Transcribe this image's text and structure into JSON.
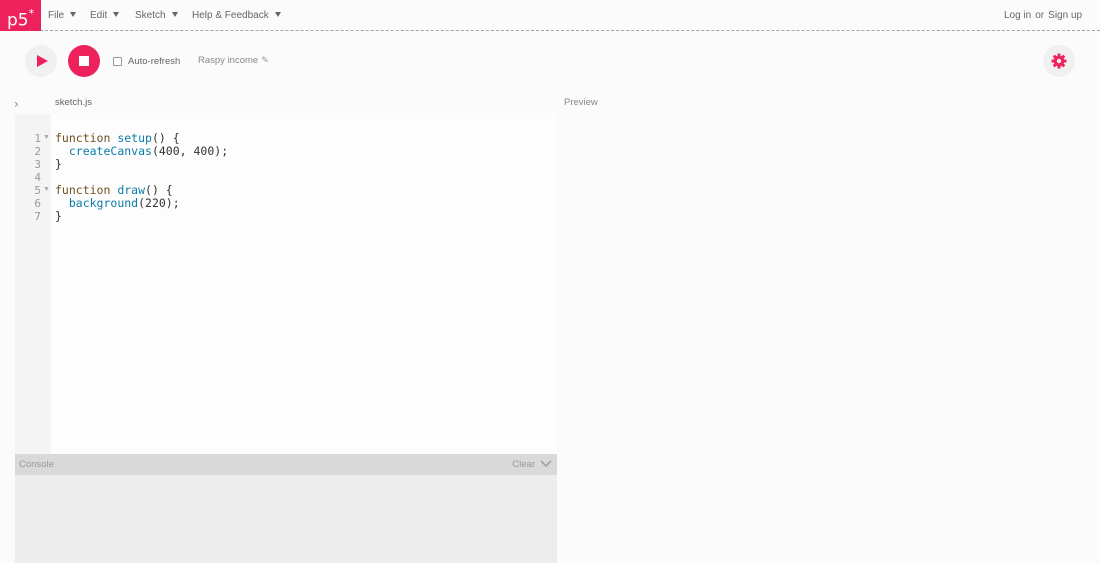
{
  "nav": {
    "logo": "p5",
    "logo_sup": "*",
    "menus": [
      "File",
      "Edit",
      "Sketch",
      "Help & Feedback"
    ],
    "login": "Log in",
    "or": "or",
    "signup": "Sign up"
  },
  "toolbar": {
    "auto_refresh_label": "Auto-refresh",
    "auto_refresh_checked": false,
    "sketch_name": "Raspy income",
    "accent_color": "#ed225d"
  },
  "editor": {
    "file_tab": "sketch.js",
    "line_numbers": [
      "1",
      "2",
      "3",
      "4",
      "5",
      "6",
      "7"
    ],
    "folds": [
      "▼",
      "▼"
    ],
    "code": {
      "l1_kw": "function",
      "l1_fn": "setup",
      "l1_rest": "() {",
      "l2_fn": "createCanvas",
      "l2_rest": "(400, 400);",
      "l3": "}",
      "l5_kw": "function",
      "l5_fn": "draw",
      "l5_rest": "() {",
      "l6_fn": "background",
      "l6_rest": "(220);",
      "l7": "}"
    }
  },
  "preview": {
    "label": "Preview"
  },
  "console": {
    "title": "Console",
    "clear": "Clear"
  },
  "icons": {
    "sidebar_toggle": "chevron-right-icon",
    "play": "play-icon",
    "stop": "stop-icon",
    "settings": "gear-icon",
    "pencil": "pencil-icon",
    "console_collapse": "chevron-down-icon"
  }
}
